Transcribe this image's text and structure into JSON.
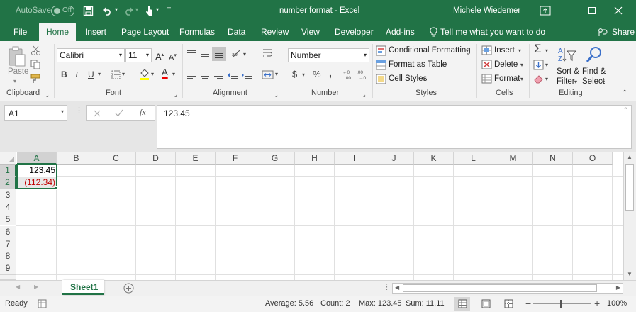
{
  "titlebar": {
    "autosave_label": "AutoSave",
    "autosave_state": "Off",
    "title": "number format  -  Excel",
    "user": "Michele Wiedemer"
  },
  "tabs": [
    "File",
    "Home",
    "Insert",
    "Page Layout",
    "Formulas",
    "Data",
    "Review",
    "View",
    "Developer",
    "Add-ins"
  ],
  "tell_me": "Tell me what you want to do",
  "share": "Share",
  "ribbon": {
    "clipboard": {
      "paste": "Paste",
      "label": "Clipboard"
    },
    "font": {
      "name": "Calibri",
      "size": "11",
      "label": "Font"
    },
    "alignment": {
      "label": "Alignment"
    },
    "number": {
      "format": "Number",
      "label": "Number",
      "pct": "%",
      "comma": ","
    },
    "styles": {
      "cond": "Conditional Formatting",
      "table": "Format as Table",
      "cell": "Cell Styles",
      "label": "Styles"
    },
    "cells": {
      "insert": "Insert",
      "delete": "Delete",
      "format": "Format",
      "label": "Cells"
    },
    "editing": {
      "sort1": "Sort &",
      "sort2": "Filter",
      "find1": "Find &",
      "find2": "Select",
      "label": "Editing"
    }
  },
  "formula_bar": {
    "name_box": "A1",
    "fx": "fx",
    "value": "123.45"
  },
  "columns": [
    "A",
    "B",
    "C",
    "D",
    "E",
    "F",
    "G",
    "H",
    "I",
    "J",
    "K",
    "L",
    "M",
    "N",
    "O"
  ],
  "rows": [
    "1",
    "2",
    "3",
    "4",
    "5",
    "6",
    "7",
    "8",
    "9"
  ],
  "cells": {
    "A1": "123.45",
    "A2": "(112.34)"
  },
  "colors": {
    "excel_green": "#217346",
    "negative_red": "#c00000"
  },
  "sheets": [
    "Sheet1"
  ],
  "status": {
    "ready": "Ready",
    "average": "Average: 5.56",
    "count": "Count: 2",
    "max": "Max: 123.45",
    "sum": "Sum: 11.11",
    "zoom": "100%"
  }
}
